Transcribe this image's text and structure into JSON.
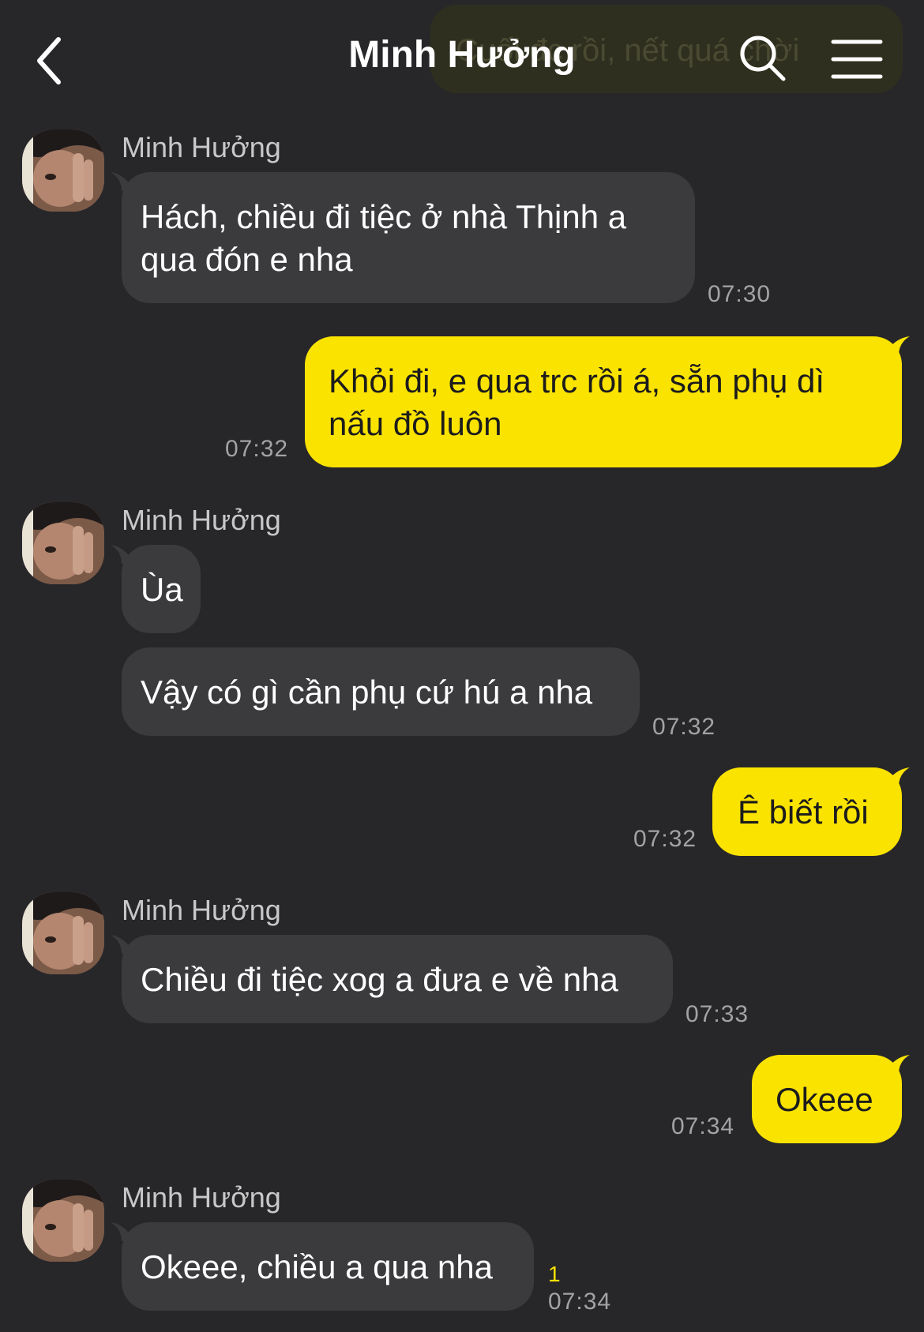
{
  "colors": {
    "background": "#27272a",
    "incoming_bubble": "#3b3b3e",
    "outgoing_bubble": "#fbe300",
    "unread": "#fbe300"
  },
  "header": {
    "title": "Minh Hưởng",
    "back_icon": "chevron-left-icon",
    "search_icon": "search-icon",
    "menu_icon": "menu-icon"
  },
  "ghost_message": {
    "text": "Cuối đc rồi, nết quá chời"
  },
  "messages": [
    {
      "sender": "Minh Hưởng",
      "lines": [
        "Hách, chiều đi tiệc ở nhà Thịnh a",
        "qua đón e nha"
      ],
      "time": "07:30"
    },
    {
      "lines": [
        "Khỏi đi, e qua trc rồi á, sẵn phụ dì",
        "nấu đồ luôn"
      ],
      "time": "07:32"
    },
    {
      "sender": "Minh Hưởng",
      "lines": [
        "Ùa"
      ]
    },
    {
      "lines": [
        "Vậy có gì cần phụ cứ hú a nha"
      ],
      "time": "07:32"
    },
    {
      "lines": [
        "Ê biết rồi"
      ],
      "time": "07:32"
    },
    {
      "sender": "Minh Hưởng",
      "lines": [
        "Chiều đi tiệc xog a đưa e về nha"
      ],
      "time": "07:33"
    },
    {
      "lines": [
        "Okeee"
      ],
      "time": "07:34"
    },
    {
      "sender": "Minh Hưởng",
      "lines": [
        "Okeee, chiều a qua nha"
      ],
      "time": "07:34",
      "unread": "1"
    }
  ]
}
